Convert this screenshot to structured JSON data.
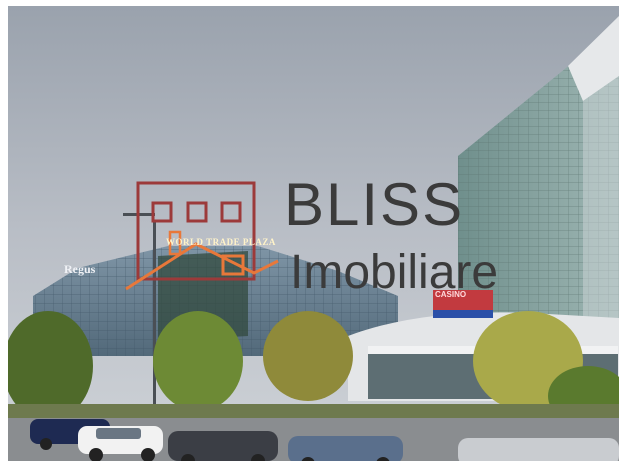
{
  "logo": {
    "line1": "BLISS",
    "line2": "Imobiliare",
    "text_color": "#3b3b3b",
    "roof_color": "#e8783a",
    "mark_color": "#9c3a3a"
  },
  "signs": {
    "regus": "Regus",
    "wtc": "WORLD TRADE PLAZA",
    "casino": "CASINO"
  }
}
